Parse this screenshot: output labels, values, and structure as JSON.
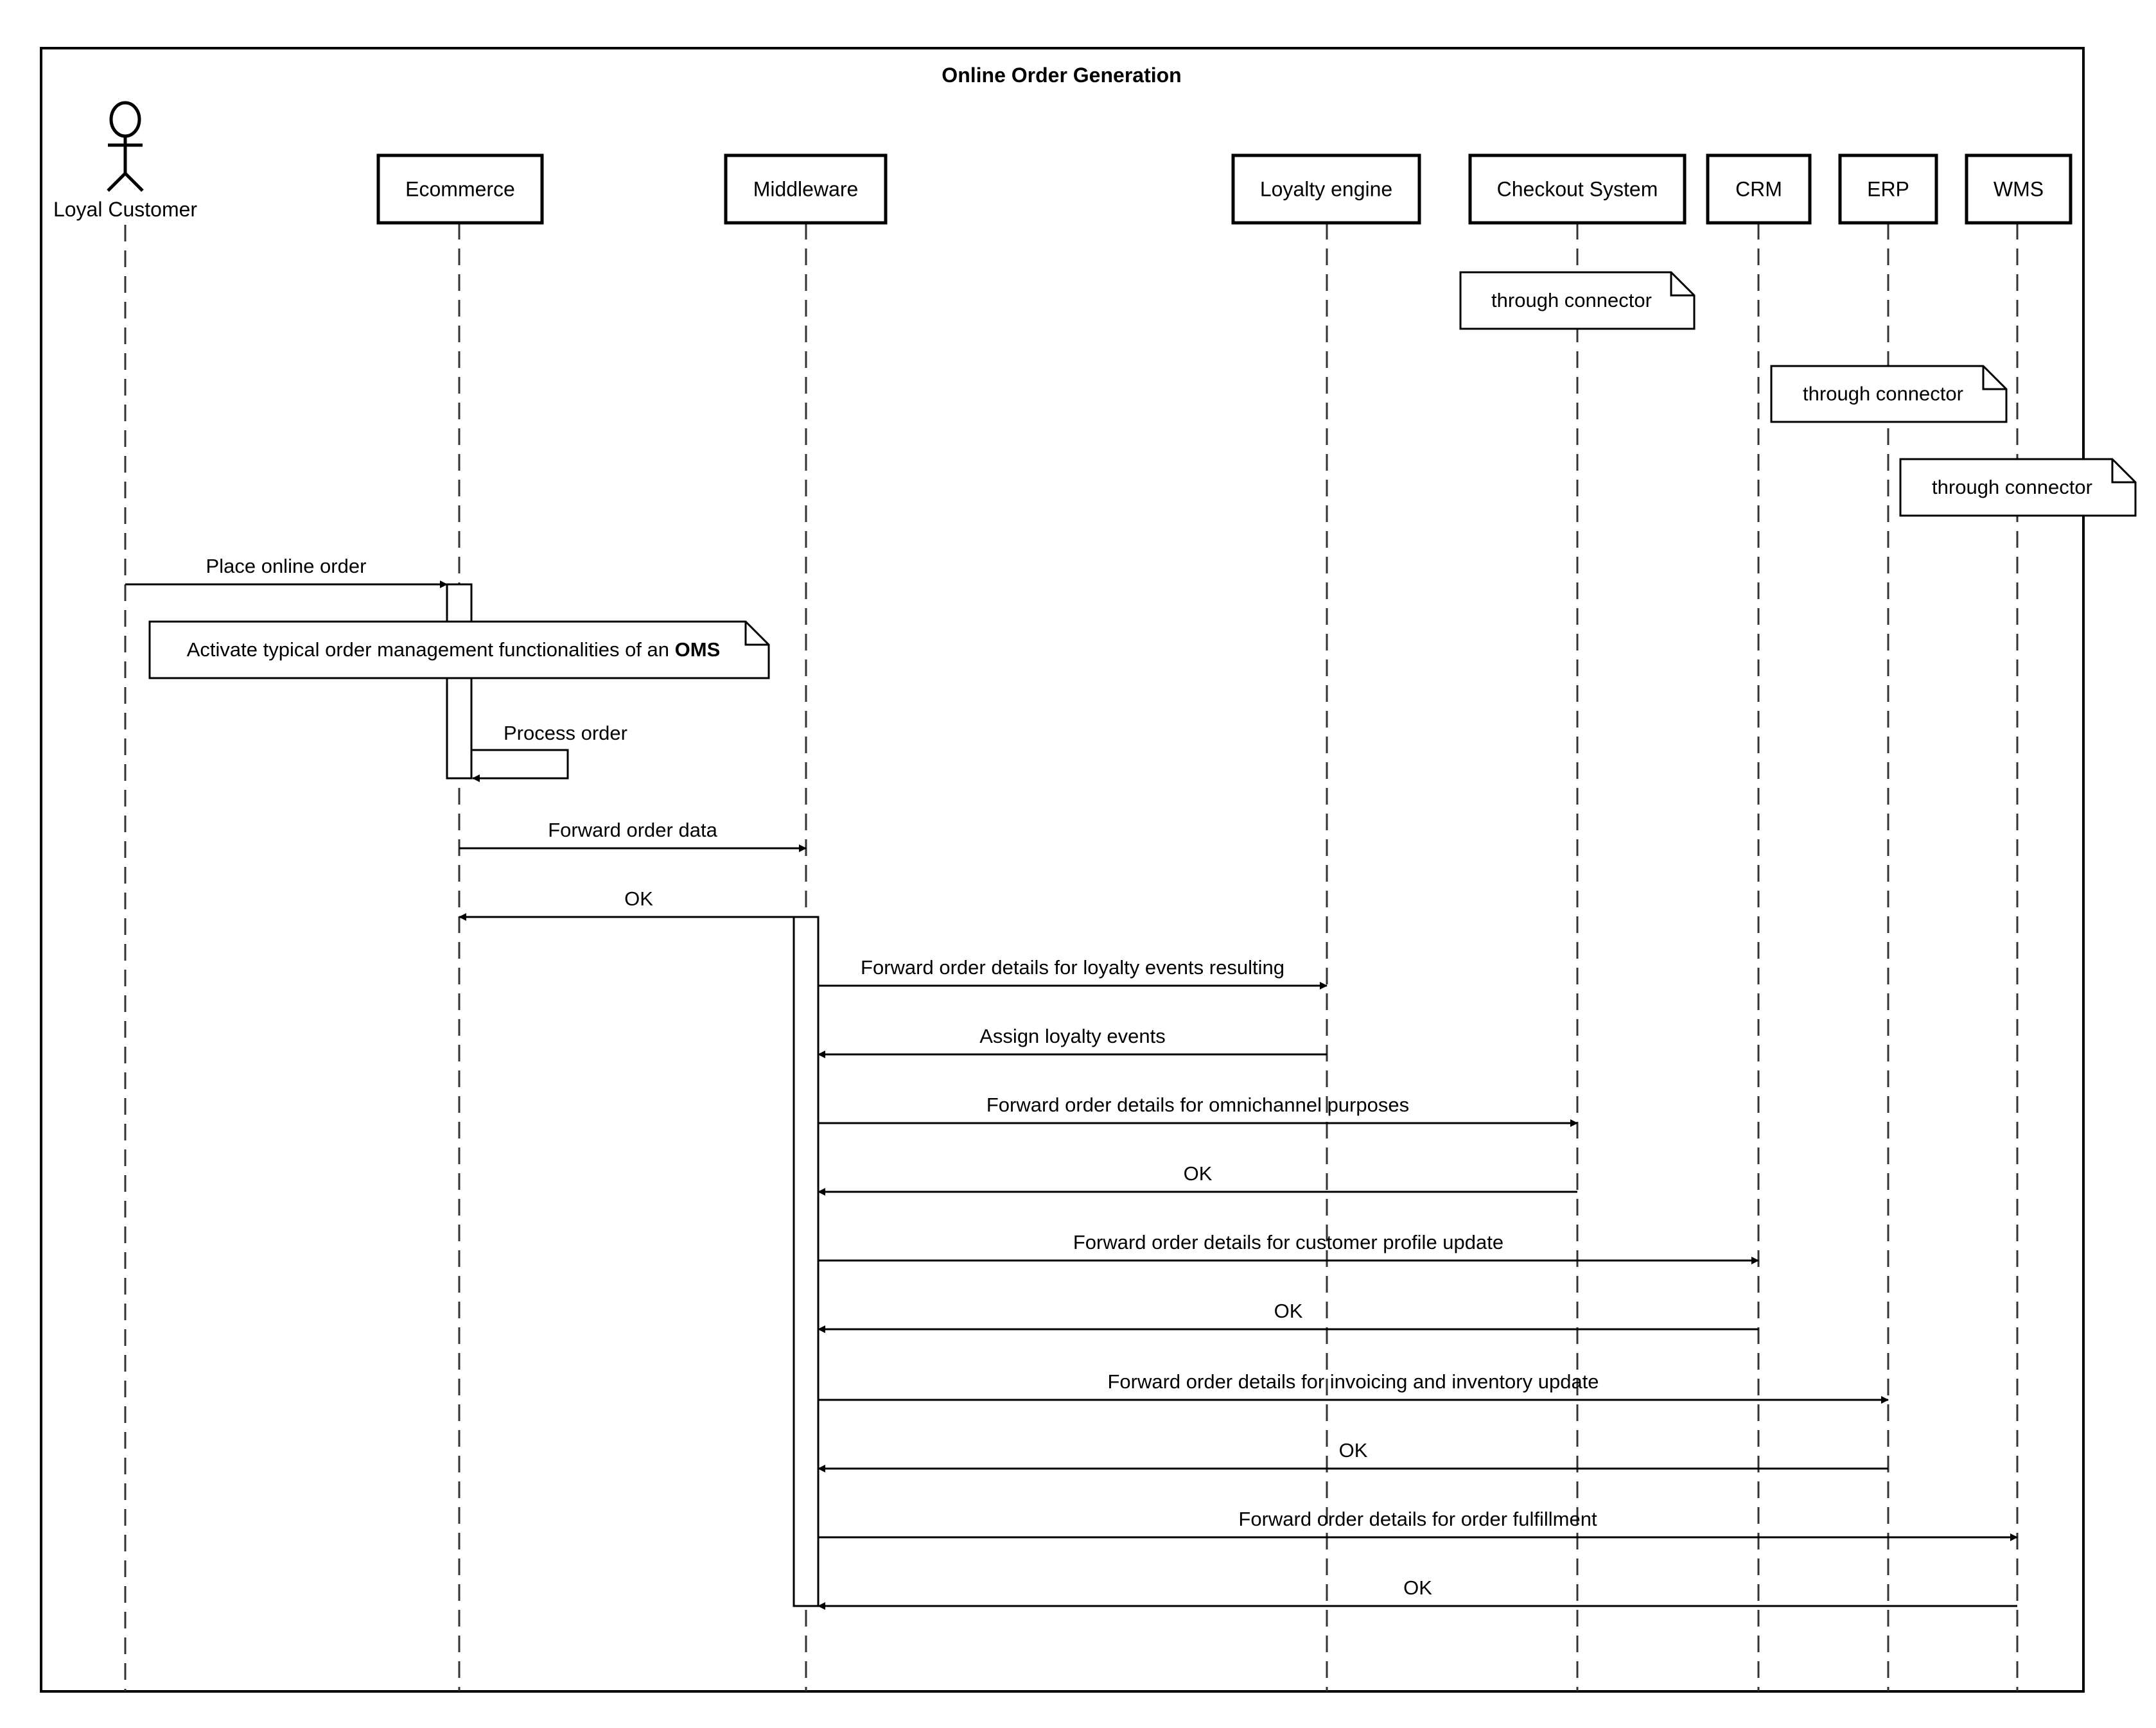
{
  "diagram": {
    "title": "Online Order Generation",
    "type": "sequence",
    "participants": [
      {
        "id": "customer",
        "label": "Loyal Customer",
        "kind": "actor"
      },
      {
        "id": "ecommerce",
        "label": "Ecommerce",
        "kind": "box"
      },
      {
        "id": "middleware",
        "label": "Middleware",
        "kind": "box"
      },
      {
        "id": "loyalty",
        "label": "Loyalty engine",
        "kind": "box"
      },
      {
        "id": "checkout",
        "label": "Checkout System",
        "kind": "box"
      },
      {
        "id": "crm",
        "label": "CRM",
        "kind": "box"
      },
      {
        "id": "erp",
        "label": "ERP",
        "kind": "box"
      },
      {
        "id": "wms",
        "label": "WMS",
        "kind": "box"
      }
    ],
    "notes": [
      {
        "over": "checkout",
        "text": "through connector"
      },
      {
        "over": "erp",
        "text": "through connector"
      },
      {
        "over": "wms",
        "text": "through connector"
      },
      {
        "over": "ecommerce",
        "text": "Activate typical order management functionalities of an ",
        "bold_suffix": "OMS"
      }
    ],
    "messages": [
      {
        "from": "customer",
        "to": "ecommerce",
        "label": "Place online order",
        "kind": "sync"
      },
      {
        "from": "ecommerce",
        "to": "ecommerce",
        "label": "Process order",
        "kind": "self"
      },
      {
        "from": "ecommerce",
        "to": "middleware",
        "label": "Forward order data",
        "kind": "sync"
      },
      {
        "from": "middleware",
        "to": "ecommerce",
        "label": "OK",
        "kind": "reply"
      },
      {
        "from": "middleware",
        "to": "loyalty",
        "label": "Forward order details for loyalty events resulting",
        "kind": "sync"
      },
      {
        "from": "loyalty",
        "to": "middleware",
        "label": "Assign loyalty events",
        "kind": "reply"
      },
      {
        "from": "middleware",
        "to": "checkout",
        "label": "Forward order details for omnichannel purposes",
        "kind": "sync"
      },
      {
        "from": "checkout",
        "to": "middleware",
        "label": "OK",
        "kind": "reply"
      },
      {
        "from": "middleware",
        "to": "crm",
        "label": "Forward order details for customer profile update",
        "kind": "sync"
      },
      {
        "from": "crm",
        "to": "middleware",
        "label": "OK",
        "kind": "reply"
      },
      {
        "from": "middleware",
        "to": "erp",
        "label": "Forward order details for invoicing and inventory update",
        "kind": "sync"
      },
      {
        "from": "erp",
        "to": "middleware",
        "label": "OK",
        "kind": "reply"
      },
      {
        "from": "middleware",
        "to": "wms",
        "label": "Forward order details for order fulfillment",
        "kind": "sync"
      },
      {
        "from": "wms",
        "to": "middleware",
        "label": "OK",
        "kind": "reply"
      }
    ],
    "activations": [
      {
        "on": "ecommerce",
        "from_message": 0,
        "to_message": 1
      },
      {
        "on": "middleware",
        "from_message": 3,
        "to_message": 13
      }
    ],
    "colors": {
      "stroke": "#000000",
      "lifeline": "#333333",
      "background": "#ffffff"
    }
  }
}
